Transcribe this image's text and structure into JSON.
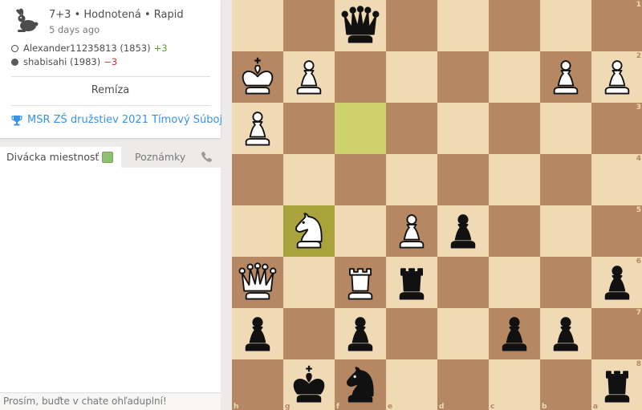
{
  "game": {
    "title": "7+3 • Hodnotená • Rapid",
    "date": "5 days ago",
    "speed_icon": "rabbit-icon",
    "white_player": {
      "name": "Alexander11235813 (1853)",
      "diff": "+3"
    },
    "black_player": {
      "name": "shabisahi (1983)",
      "diff": "−3"
    },
    "result": "Remíza",
    "tournament": "MSR ZŠ družstiev 2021 Tímový Súboj",
    "tournament_icon": "trophy-icon"
  },
  "chat": {
    "tab_chat": "Divácka miestnosť",
    "tab_notes": "Poznámky",
    "input_placeholder": "Prosím, buďte v chate ohľaduplní!"
  },
  "board": {
    "orientation": "black",
    "ranks": [
      "1",
      "2",
      "3",
      "4",
      "5",
      "6",
      "7",
      "8"
    ],
    "files": [
      "h",
      "g",
      "f",
      "e",
      "d",
      "c",
      "b",
      "a"
    ],
    "highlights": [
      "f3",
      "g5"
    ],
    "pieces": [
      {
        "sq": "f1",
        "color": "b",
        "type": "Q"
      },
      {
        "sq": "h2",
        "color": "w",
        "type": "K"
      },
      {
        "sq": "g2",
        "color": "w",
        "type": "P"
      },
      {
        "sq": "b2",
        "color": "w",
        "type": "P"
      },
      {
        "sq": "a2",
        "color": "w",
        "type": "P"
      },
      {
        "sq": "h3",
        "color": "w",
        "type": "P"
      },
      {
        "sq": "g5",
        "color": "w",
        "type": "N"
      },
      {
        "sq": "e5",
        "color": "w",
        "type": "P"
      },
      {
        "sq": "d5",
        "color": "b",
        "type": "P"
      },
      {
        "sq": "h6",
        "color": "w",
        "type": "Q"
      },
      {
        "sq": "f6",
        "color": "w",
        "type": "R"
      },
      {
        "sq": "e6",
        "color": "b",
        "type": "R"
      },
      {
        "sq": "a6",
        "color": "b",
        "type": "P"
      },
      {
        "sq": "h7",
        "color": "b",
        "type": "P"
      },
      {
        "sq": "f7",
        "color": "b",
        "type": "P"
      },
      {
        "sq": "c7",
        "color": "b",
        "type": "P"
      },
      {
        "sq": "b7",
        "color": "b",
        "type": "P"
      },
      {
        "sq": "g8",
        "color": "b",
        "type": "K"
      },
      {
        "sq": "f8",
        "color": "b",
        "type": "N"
      },
      {
        "sq": "a8",
        "color": "b",
        "type": "R"
      }
    ]
  }
}
